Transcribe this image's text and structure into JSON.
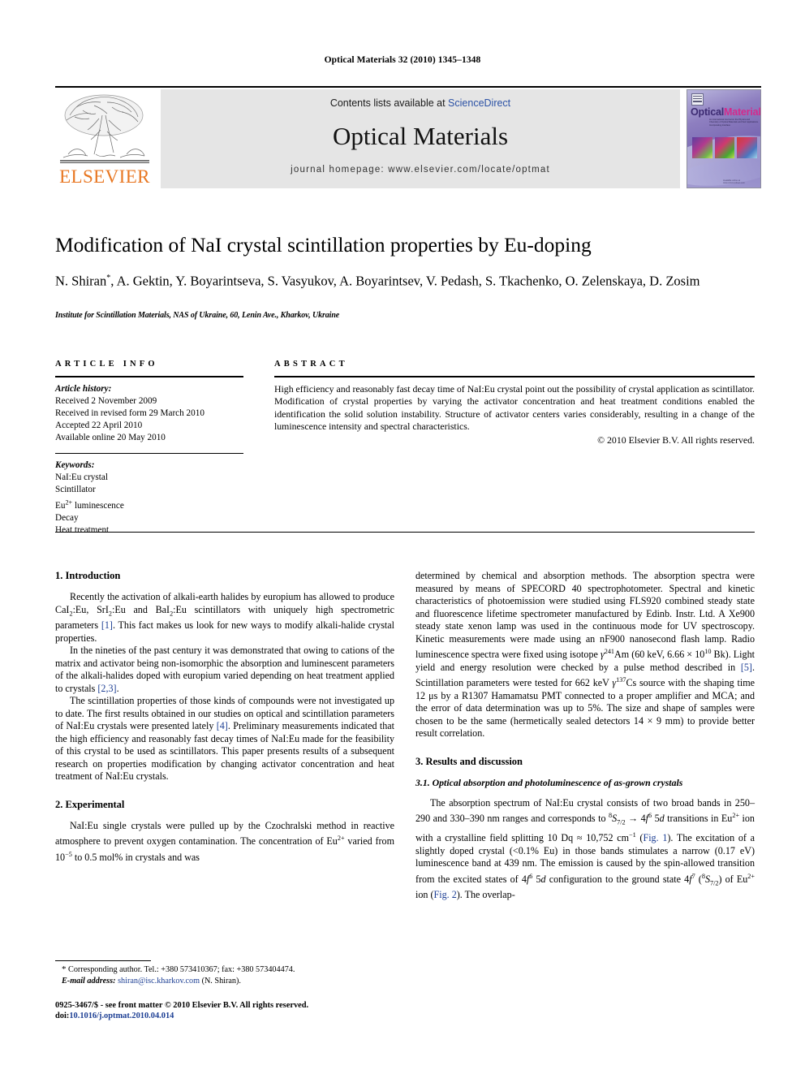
{
  "running_head": "Optical Materials 32 (2010) 1345–1348",
  "header": {
    "publisher_name": "ELSEVIER",
    "contents_prefix": "Contents lists available at ",
    "contents_link": "ScienceDirect",
    "journal_name": "Optical Materials",
    "homepage": "journal homepage: www.elsevier.com/locate/optmat",
    "cover": {
      "title_part1": "Optical",
      "title_part2": "Materials",
      "subtitle": "An International Journal on the Physics and Chemistry of Optical Materials and their Applications. Incorporating Interface",
      "footline": "Available online at www.sciencedirect.com"
    }
  },
  "article": {
    "title": "Modification of NaI crystal scintillation properties by Eu-doping",
    "authors": "N. Shiran *, A. Gektin, Y. Boyarintseva, S. Vasyukov, A. Boyarintsev, V. Pedash, S. Tkachenko, O. Zelenskaya, D. Zosim",
    "affiliation": "Institute for Scintillation Materials, NAS of Ukraine, 60, Lenin Ave., Kharkov, Ukraine"
  },
  "article_info": {
    "heading": "ARTICLE INFO",
    "history_label": "Article history:",
    "history": [
      "Received 2 November 2009",
      "Received in revised form 29 March 2010",
      "Accepted 22 April 2010",
      "Available online 20 May 2010"
    ],
    "keywords_label": "Keywords:",
    "keywords": [
      "NaI:Eu crystal",
      "Scintillator",
      "Eu2+ luminescence",
      "Decay",
      "Heat treatment"
    ]
  },
  "abstract": {
    "heading": "ABSTRACT",
    "text": "High efficiency and reasonably fast decay time of NaI:Eu crystal point out the possibility of crystal application as scintillator. Modification of crystal properties by varying the activator concentration and heat treatment conditions enabled the identification the solid solution instability. Structure of activator centers varies considerably, resulting in a change of the luminescence intensity and spectral characteristics.",
    "copyright": "© 2010 Elsevier B.V. All rights reserved."
  },
  "sections": {
    "introduction_heading": "1. Introduction",
    "intro_p1_a": "Recently the activation of alkali-earth halides by europium has allowed to produce CaI",
    "intro_p1_b": ":Eu, SrI",
    "intro_p1_c": ":Eu and BaI",
    "intro_p1_d": ":Eu scintillators with uniquely high spectrometric parameters ",
    "intro_p1_ref": "[1]",
    "intro_p1_e": ". This fact makes us look for new ways to modify alkali-halide crystal properties.",
    "intro_p2_a": "In the nineties of the past century it was demonstrated that owing to cations of the matrix and activator being non-isomorphic the absorption and luminescent parameters of the alkali-halides doped with europium varied depending on heat treatment applied to crystals ",
    "intro_p2_ref": "[2,3]",
    "intro_p2_b": ".",
    "intro_p3_a": "The scintillation properties of those kinds of compounds were not investigated up to date. The first results obtained in our studies on optical and scintillation parameters of NaI:Eu crystals were presented lately ",
    "intro_p3_ref": "[4]",
    "intro_p3_b": ". Preliminary measurements indicated that the high efficiency and reasonably fast decay times of NaI:Eu made for the feasibility of this crystal to be used as scintillators. This paper presents results of a subsequent research on properties modification by changing activator concentration and heat treatment of NaI:Eu crystals.",
    "experimental_heading": "2. Experimental",
    "exp_p1_a": "NaI:Eu single crystals were pulled up by the Czochralski method in reactive atmosphere to prevent oxygen contamination. The concentration of Eu",
    "exp_p1_sup1": "2+",
    "exp_p1_b": " varied from 10",
    "exp_p1_sup2": "−5",
    "exp_p1_c": " to 0.5 mol% in crystals and was determined by chemical and absorption methods. The absorption spectra were measured by means of SPECORD 40 spectrophotometer. Spectral and kinetic characteristics of photoemission were studied using FLS920 combined steady state and fluorescence lifetime spectrometer manufactured by Edinb. Instr. Ltd. A Xe900 steady state xenon lamp was used in the continuous mode for UV spectroscopy. Kinetic measurements were made using an nF900 nanosecond flash lamp. Radio luminescence spectra were fixed using isotope ",
    "exp_p1_gamma": "γ",
    "exp_p1_sup3": "241",
    "exp_p1_d": "Am (60 keV, 6.66 × 10",
    "exp_p1_sup4": "10",
    "exp_p1_e": " Bk). Light yield and energy resolution were checked by a pulse method described in ",
    "exp_p1_ref": "[5]",
    "exp_p1_f": ". Scintillation parameters were tested for 662 keV ",
    "exp_p1_sup5": "137",
    "exp_p1_g": "Cs source with the shaping time 12 μs by a R1307 Hamamatsu PMT connected to a proper amplifier and MCA; and the error of data determination was up to 5%. The size and shape of samples were chosen to be the same (hermetically sealed detectors 14 × 9 mm) to provide better result correlation.",
    "results_heading": "3. Results and discussion",
    "results_sub_heading": "3.1. Optical absorption and photoluminescence of as-grown crystals",
    "res_p1_a": "The absorption spectrum of NaI:Eu crystal consists of two broad bands in 250–290 and 330–390 nm ranges and corresponds to ",
    "res_p1_sup1": "8",
    "res_p1_s1": "S",
    "res_p1_sub1": "7/2",
    "res_p1_b": " → 4",
    "res_p1_f1": "f",
    "res_p1_sup2": "6",
    "res_p1_c": " 5",
    "res_p1_d1": "d",
    "res_p1_d": " transitions in Eu",
    "res_p1_sup3": "2+",
    "res_p1_e": " ion with a crystalline field splitting 10 Dq ≈ 10,752 cm",
    "res_p1_sup4": "−1",
    "res_p1_f": " (",
    "res_p1_fig1": "Fig. 1",
    "res_p1_g": "). The excitation of a slightly doped crystal (<0.1% Eu) in those bands stimulates a narrow (0.17 eV) luminescence band at 439 nm. The emission is caused by the spin-allowed transition from the excited states of 4",
    "res_p1_f2": "f",
    "res_p1_sup5": "6",
    "res_p1_h": " 5",
    "res_p1_d2": "d",
    "res_p1_i": " configuration to the ground state 4",
    "res_p1_f3": "f",
    "res_p1_sup6": "7",
    "res_p1_j": " (",
    "res_p1_sup7": "8",
    "res_p1_s2": "S",
    "res_p1_sub2": "7/2",
    "res_p1_k": ") of Eu",
    "res_p1_sup8": "2+",
    "res_p1_l": " ion (",
    "res_p1_fig2": "Fig. 2",
    "res_p1_m": "). The overlap-"
  },
  "footnote": {
    "star": "*",
    "corresponding": "Corresponding author. Tel.: +380 573410367; fax: +380 573404474.",
    "email_label": "E-mail address:",
    "email": "shiran@isc.kharkov.com",
    "email_suffix": " (N. Shiran)."
  },
  "imprint": {
    "line1": "0925-3467/$ - see front matter © 2010 Elsevier B.V. All rights reserved.",
    "doi_label": "doi:",
    "doi": "10.1016/j.optmat.2010.04.014"
  },
  "colors": {
    "elsevier_orange": "#e87722",
    "link_blue": "#1d3f94",
    "sciencedirect_blue": "#2b51a5",
    "band_gray": "#e5e5e5",
    "cover_purple": "#3c2a72",
    "cover_magenta": "#d42a8c"
  }
}
